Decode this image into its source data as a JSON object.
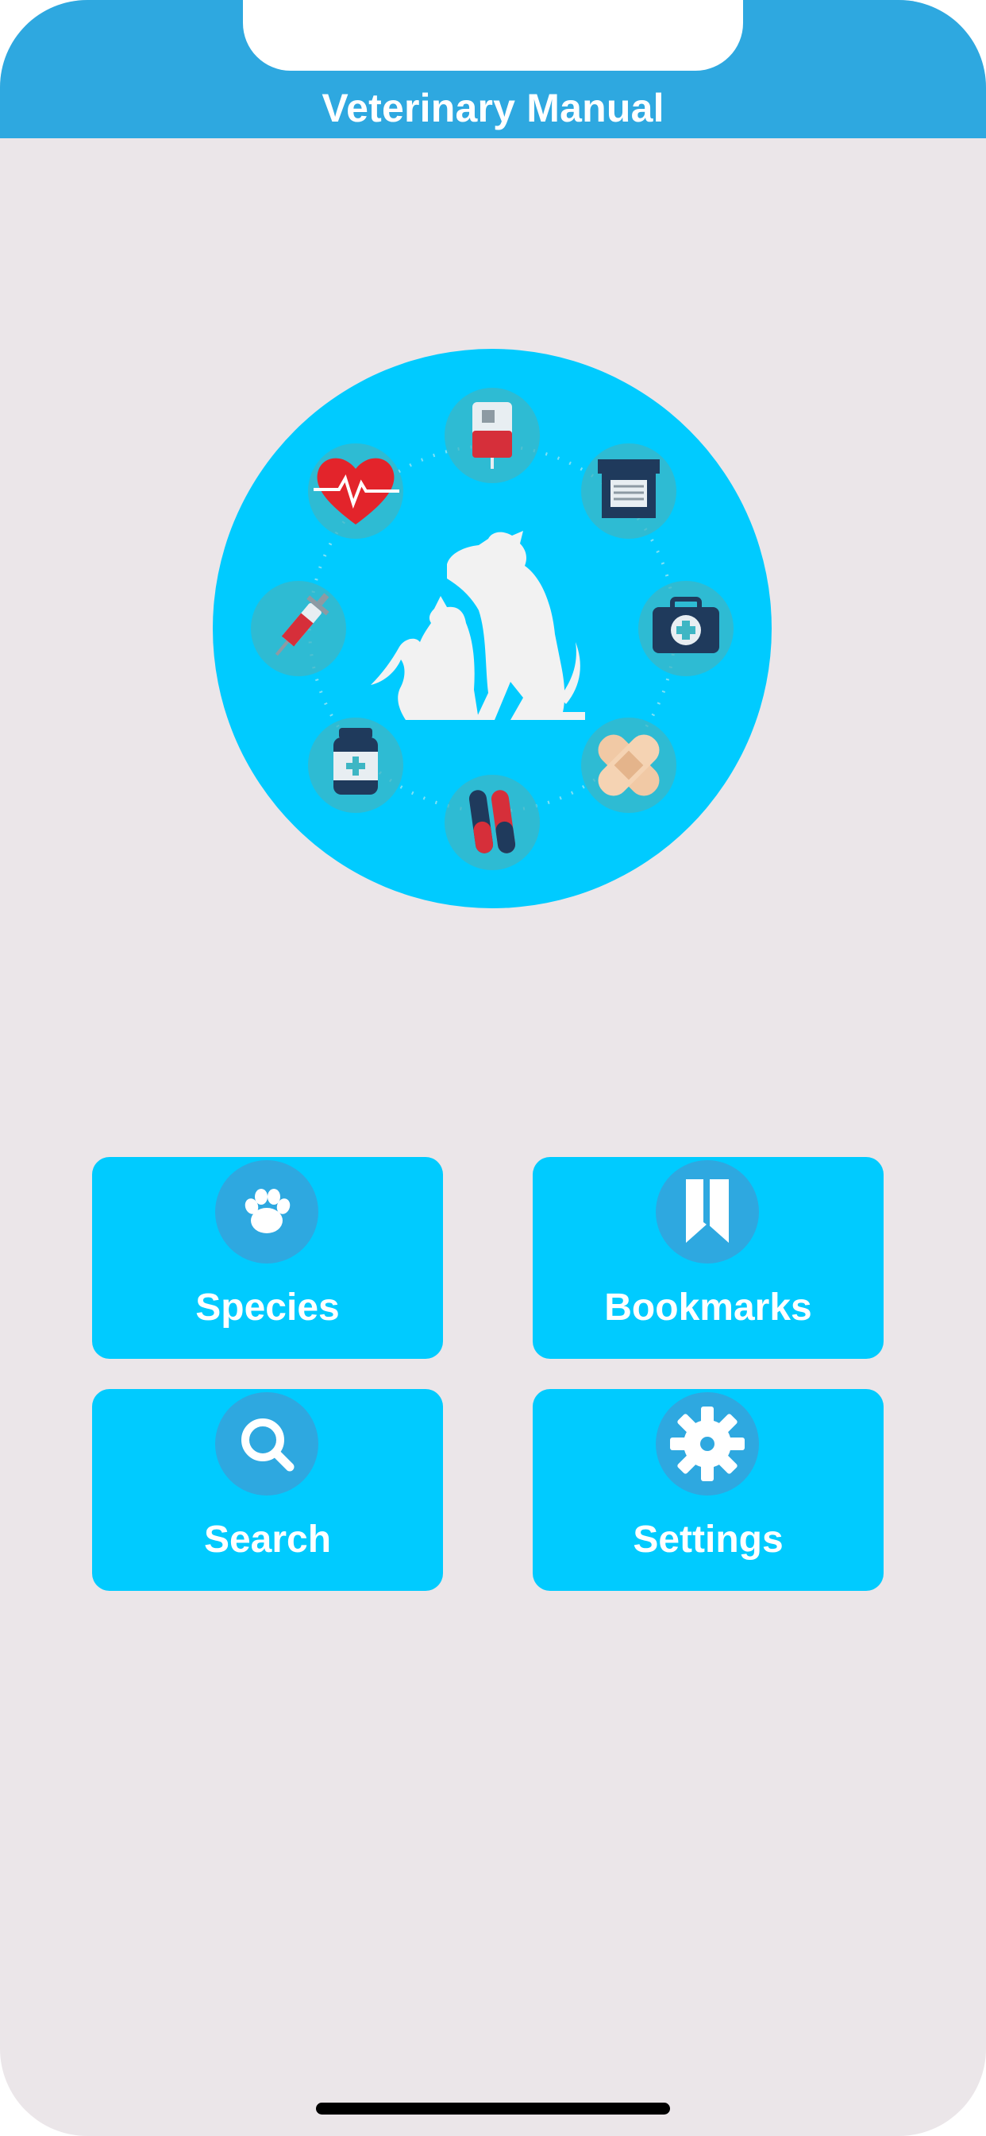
{
  "app": {
    "title": "Veterinary Manual"
  },
  "menu": {
    "items": [
      {
        "label": "Species",
        "icon": "paw-icon"
      },
      {
        "label": "Bookmarks",
        "icon": "bookmark-icon"
      },
      {
        "label": "Search",
        "icon": "search-icon"
      },
      {
        "label": "Settings",
        "icon": "gear-icon"
      }
    ]
  },
  "colors": {
    "nav_bar": "#2ea8e0",
    "tile": "#00cbff",
    "tile_icon_circle": "#2ea8e0",
    "background": "#ebe6e9",
    "logo_circle": "#00cbff"
  }
}
